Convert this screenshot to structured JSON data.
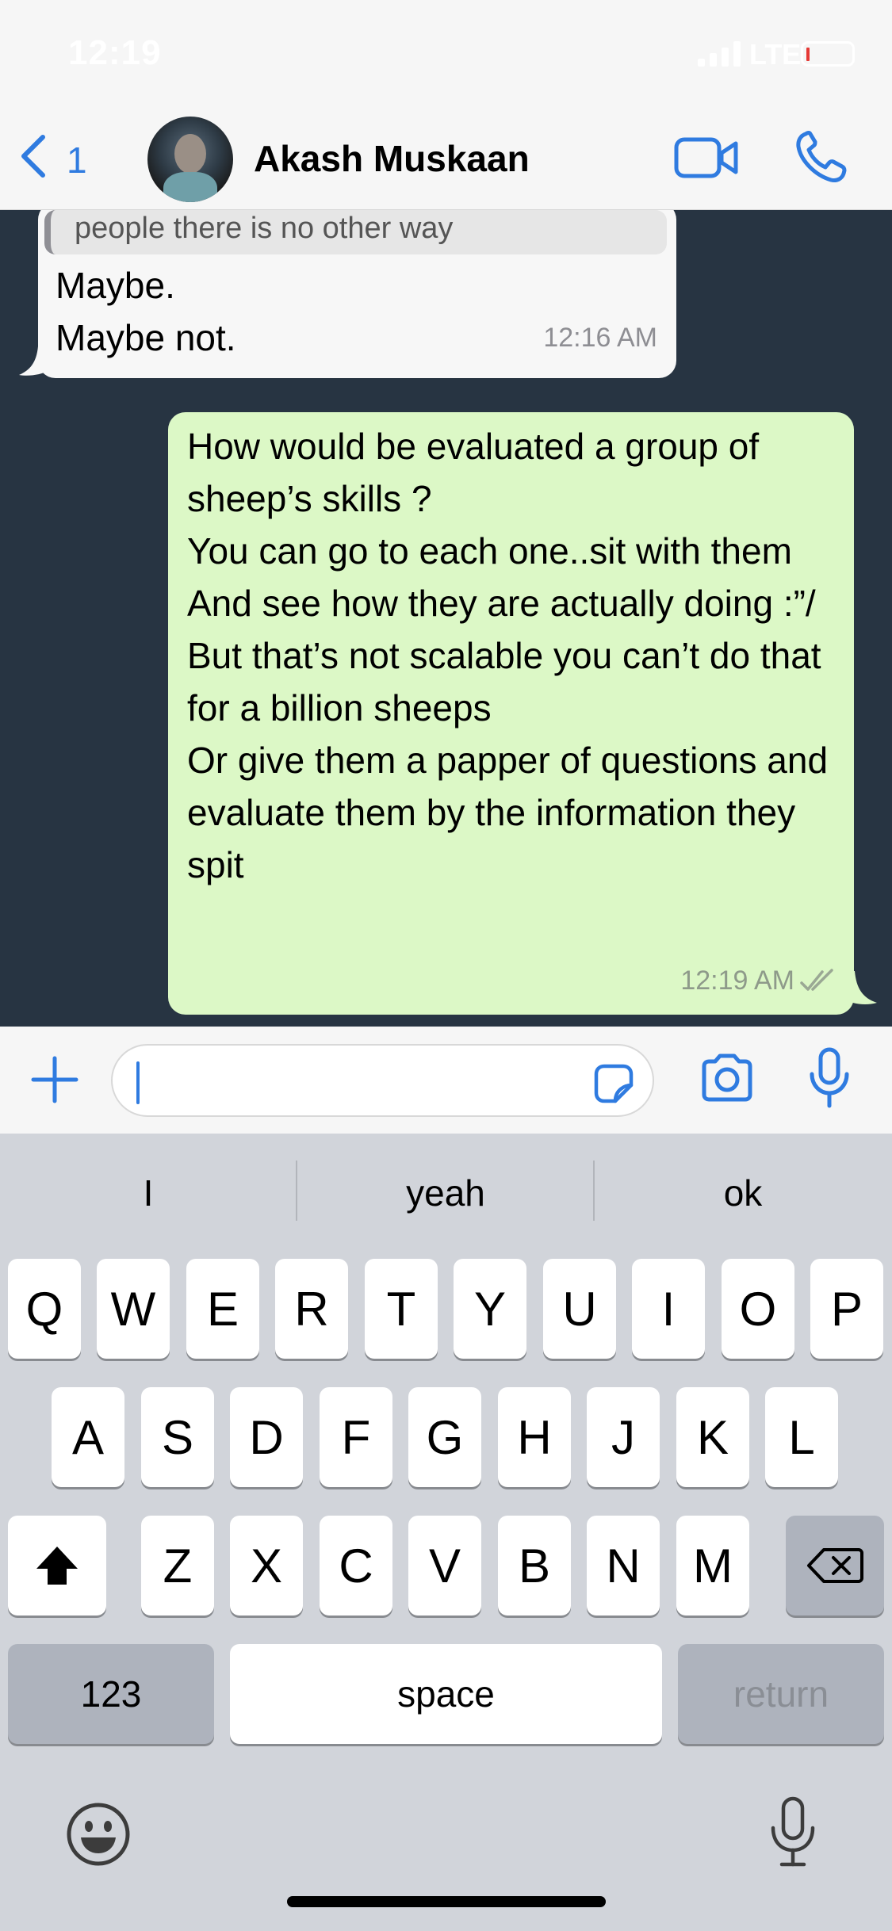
{
  "status_bar": {
    "time": "12:19",
    "network": "LTE",
    "battery_level": 0.05
  },
  "header": {
    "back_count": "1",
    "contact_name": "Akash Muskaan",
    "icons": [
      "chevron-left-icon",
      "video-call-icon",
      "phone-icon"
    ]
  },
  "messages": {
    "incoming": {
      "quoted_text": "people there is no other way",
      "text": "Maybe.\nMaybe not.",
      "time": "12:16 AM"
    },
    "outgoing": {
      "text": "How would be evaluated a group of sheep’s skills ?\nYou can go to each one..sit with them\nAnd see how they are actually doing :”/\nBut that’s not scalable you  can’t do that for a billion sheeps\nOr give them a papper of questions and evaluate them by the information they spit",
      "time": "12:19 AM",
      "status": "read"
    }
  },
  "input": {
    "value": "",
    "placeholder": ""
  },
  "keyboard": {
    "suggestions": [
      "I",
      "yeah",
      "ok"
    ],
    "row1": [
      "Q",
      "W",
      "E",
      "R",
      "T",
      "Y",
      "U",
      "I",
      "O",
      "P"
    ],
    "row2": [
      "A",
      "S",
      "D",
      "F",
      "G",
      "H",
      "J",
      "K",
      "L"
    ],
    "row3": [
      "Z",
      "X",
      "C",
      "V",
      "B",
      "N",
      "M"
    ],
    "numbers_label": "123",
    "space_label": "space",
    "return_label": "return"
  },
  "colors": {
    "accent": "#2f7be0",
    "chat_background": "#273442",
    "outgoing_bubble": "#dcf8c6",
    "incoming_bubble": "#f7f7f7"
  }
}
